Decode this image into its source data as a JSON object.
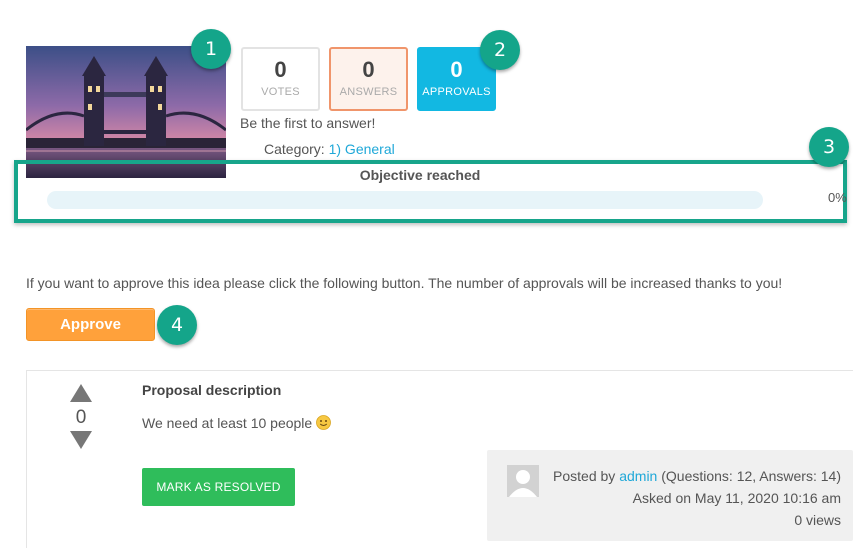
{
  "stats": {
    "votes": {
      "value": "0",
      "label": "VOTES"
    },
    "answers": {
      "value": "0",
      "label": "ANSWERS"
    },
    "approvals": {
      "value": "0",
      "label": "APPROVALS"
    }
  },
  "first_answer": "Be the first to answer!",
  "category": {
    "label": "Category:",
    "value": "1) General"
  },
  "objective": {
    "title": "Objective reached",
    "progress_percent": 0,
    "percent_text": "0%"
  },
  "approve": {
    "text": "If you want to approve this idea please click the following button. The number of approvals will be increased thanks to you!",
    "button": "Approve"
  },
  "badges": {
    "b1": "1",
    "b2": "2",
    "b3": "3",
    "b4": "4"
  },
  "question": {
    "vote_count": "0",
    "desc_title": "Proposal description",
    "desc_body": "We need at least 10 people",
    "resolve_button": "MARK AS RESOLVED"
  },
  "author": {
    "posted_by": "Posted by",
    "name": "admin",
    "stats": "(Questions: 12, Answers: 14)",
    "asked": "Asked on May 11, 2020 10:16 am",
    "views": "0 views"
  },
  "colors": {
    "accent_teal": "#17a58b",
    "link_blue": "#1fa8d8",
    "approve_orange": "#ffa13b",
    "resolve_green": "#2fbd5b",
    "approvals_blue": "#12b8e2"
  }
}
